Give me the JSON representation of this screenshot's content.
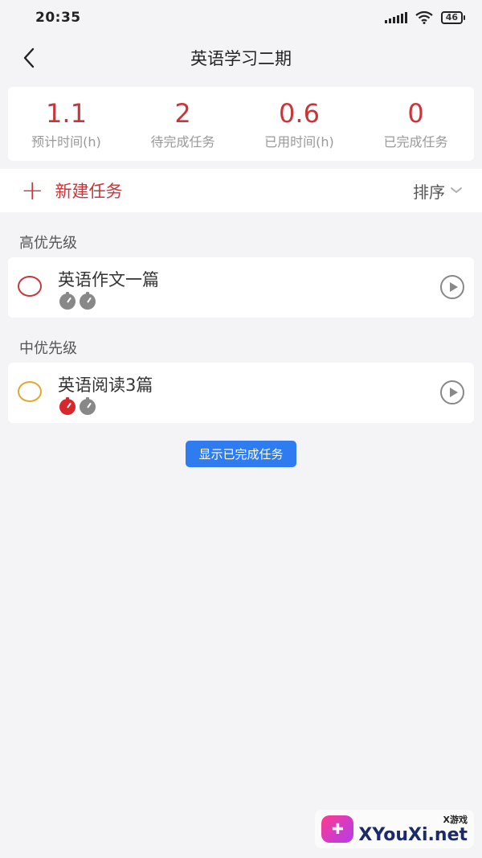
{
  "status_bar": {
    "time": "20:35",
    "battery": "46"
  },
  "header": {
    "title": "英语学习二期"
  },
  "stats": [
    {
      "value": "1.1",
      "label": "预计时间(h)"
    },
    {
      "value": "2",
      "label": "待完成任务"
    },
    {
      "value": "0.6",
      "label": "已用时间(h)"
    },
    {
      "value": "0",
      "label": "已完成任务"
    }
  ],
  "toolbar": {
    "plus": "+",
    "new_task_label": "新建任务",
    "sort_label": "排序"
  },
  "sections": [
    {
      "title": "高优先级",
      "tasks": [
        {
          "name": "英语作文一篇",
          "radio_color": "#c8363b",
          "clocks": [
            "#888888",
            "#888888"
          ]
        }
      ]
    },
    {
      "title": "中优先级",
      "tasks": [
        {
          "name": "英语阅读3篇",
          "radio_color": "#e0a92a",
          "clocks": [
            "#d9262b",
            "#888888"
          ]
        }
      ]
    }
  ],
  "show_done_label": "显示已完成任务",
  "watermark": {
    "small": "X游戏",
    "big": "XYouXi.net"
  },
  "colors": {
    "accent": "#c8363b",
    "button_blue": "#2f7cf0",
    "background": "#f4f4f6"
  }
}
